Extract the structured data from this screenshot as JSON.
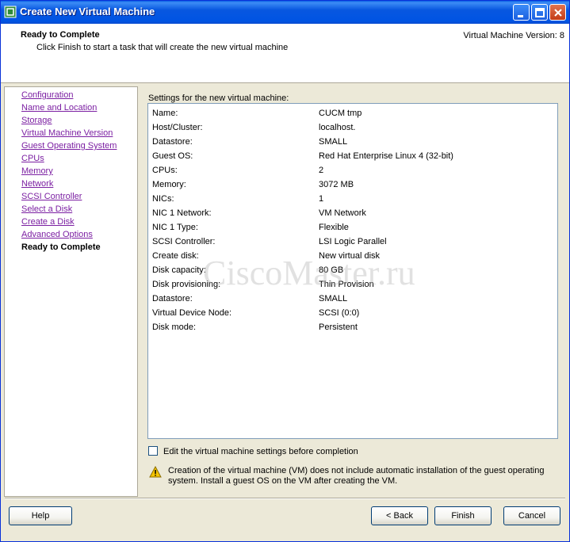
{
  "window": {
    "title": "Create New Virtual Machine"
  },
  "header": {
    "title": "Ready to Complete",
    "subtitle": "Click Finish to start a task that will create the new virtual machine",
    "version": "Virtual Machine Version: 8"
  },
  "sidebar": {
    "items": [
      {
        "label": "Configuration",
        "current": false
      },
      {
        "label": "Name and Location",
        "current": false
      },
      {
        "label": "Storage",
        "current": false
      },
      {
        "label": "Virtual Machine Version",
        "current": false
      },
      {
        "label": "Guest Operating System",
        "current": false
      },
      {
        "label": "CPUs",
        "current": false
      },
      {
        "label": "Memory",
        "current": false
      },
      {
        "label": "Network",
        "current": false
      },
      {
        "label": "SCSI Controller",
        "current": false
      },
      {
        "label": "Select a Disk",
        "current": false
      },
      {
        "label": "Create a Disk",
        "current": false
      },
      {
        "label": "Advanced Options",
        "current": false
      },
      {
        "label": "Ready to Complete",
        "current": true
      }
    ]
  },
  "settings": {
    "label": "Settings for the new virtual machine:",
    "rows": [
      {
        "key": "Name:",
        "value": "CUCM tmp"
      },
      {
        "key": "Host/Cluster:",
        "value": "localhost."
      },
      {
        "key": "Datastore:",
        "value": "SMALL"
      },
      {
        "key": "Guest OS:",
        "value": "Red Hat Enterprise Linux 4 (32-bit)"
      },
      {
        "key": "CPUs:",
        "value": "2"
      },
      {
        "key": "Memory:",
        "value": "3072 MB"
      },
      {
        "key": "NICs:",
        "value": "1"
      },
      {
        "key": "NIC 1 Network:",
        "value": "VM Network"
      },
      {
        "key": "NIC 1 Type:",
        "value": "Flexible"
      },
      {
        "key": "SCSI Controller:",
        "value": "LSI Logic Parallel"
      },
      {
        "key": "Create disk:",
        "value": "New virtual disk"
      },
      {
        "key": "Disk capacity:",
        "value": "80 GB"
      },
      {
        "key": "Disk provisioning:",
        "value": "Thin Provision"
      },
      {
        "key": "Datastore:",
        "value": "SMALL"
      },
      {
        "key": "Virtual Device Node:",
        "value": "SCSI (0:0)"
      },
      {
        "key": "Disk mode:",
        "value": "Persistent"
      }
    ]
  },
  "edit_checkbox": {
    "label": "Edit the virtual machine settings before completion",
    "checked": false
  },
  "warning": {
    "icon": "warning-icon",
    "text": "Creation of the virtual machine (VM) does not include automatic installation of the guest operating system. Install a guest OS on the VM after creating the VM."
  },
  "buttons": {
    "help": "Help",
    "back": "< Back",
    "finish": "Finish",
    "cancel": "Cancel"
  },
  "watermark": "CiscoMaster.ru"
}
